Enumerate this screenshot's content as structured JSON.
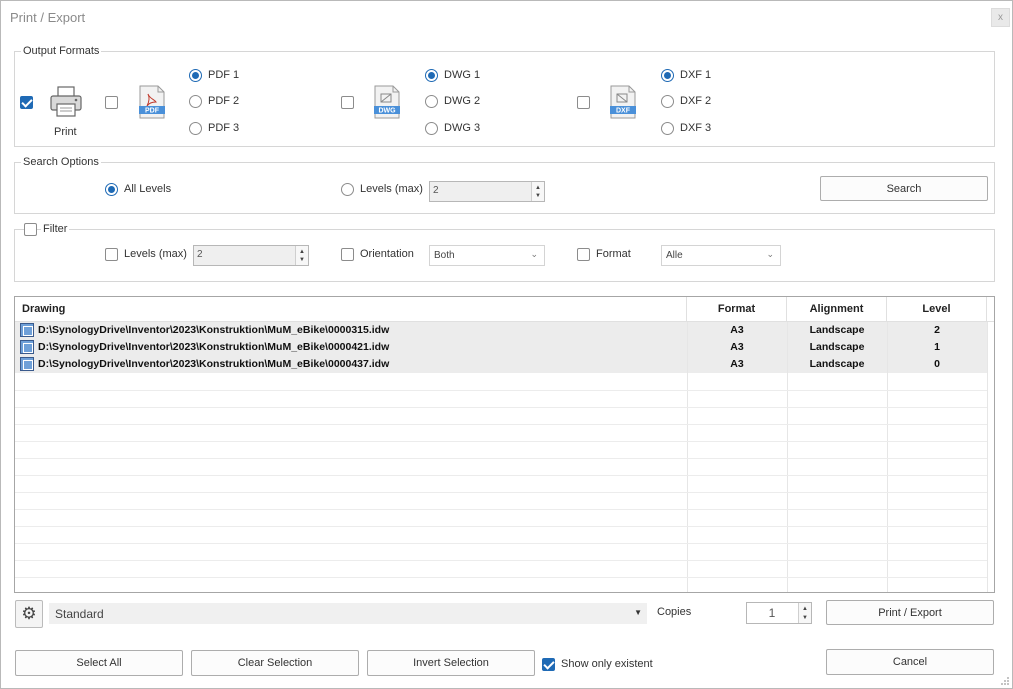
{
  "window": {
    "title": "Print / Export",
    "close_label": "x"
  },
  "output_formats": {
    "legend": "Output Formats",
    "print_label": "Print",
    "pdf_icon_label": "PDF",
    "dwg_icon_label": "DWG",
    "dxf_icon_label": "DXF",
    "pdf_options": [
      "PDF 1",
      "PDF 2",
      "PDF 3"
    ],
    "dwg_options": [
      "DWG 1",
      "DWG 2",
      "DWG 3"
    ],
    "dxf_options": [
      "DXF 1",
      "DXF 2",
      "DXF 3"
    ]
  },
  "search_options": {
    "legend": "Search Options",
    "all_levels_label": "All Levels",
    "levels_max_label": "Levels (max)",
    "levels_value": "2",
    "search_button": "Search"
  },
  "filter": {
    "legend": "Filter",
    "levels_label": "Levels (max)",
    "levels_value": "2",
    "orientation_label": "Orientation",
    "orientation_value": "Both",
    "format_label": "Format",
    "format_value": "Alle"
  },
  "grid": {
    "columns": [
      "Drawing",
      "Format",
      "Alignment",
      "Level"
    ],
    "rows": [
      {
        "drawing": "D:\\SynologyDrive\\Inventor\\2023\\Konstruktion\\MuM_eBike\\0000315.idw",
        "format": "A3",
        "alignment": "Landscape",
        "level": "2"
      },
      {
        "drawing": "D:\\SynologyDrive\\Inventor\\2023\\Konstruktion\\MuM_eBike\\0000421.idw",
        "format": "A3",
        "alignment": "Landscape",
        "level": "1"
      },
      {
        "drawing": "D:\\SynologyDrive\\Inventor\\2023\\Konstruktion\\MuM_eBike\\0000437.idw",
        "format": "A3",
        "alignment": "Landscape",
        "level": "0"
      }
    ]
  },
  "bottom": {
    "preset_value": "Standard",
    "copies_label": "Copies",
    "copies_value": "1",
    "print_export_button": "Print / Export",
    "select_all_button": "Select All",
    "clear_selection_button": "Clear Selection",
    "invert_selection_button": "Invert Selection",
    "show_only_existent_label": "Show only existent",
    "cancel_button": "Cancel"
  },
  "colors": {
    "accent": "#1f6ab5",
    "row_fill": "#ececec",
    "border": "#d6d6d6"
  },
  "icons": [
    "printer-icon",
    "pdf-file-icon",
    "dwg-file-icon",
    "dxf-file-icon",
    "gear-icon",
    "drawing-file-icon"
  ]
}
